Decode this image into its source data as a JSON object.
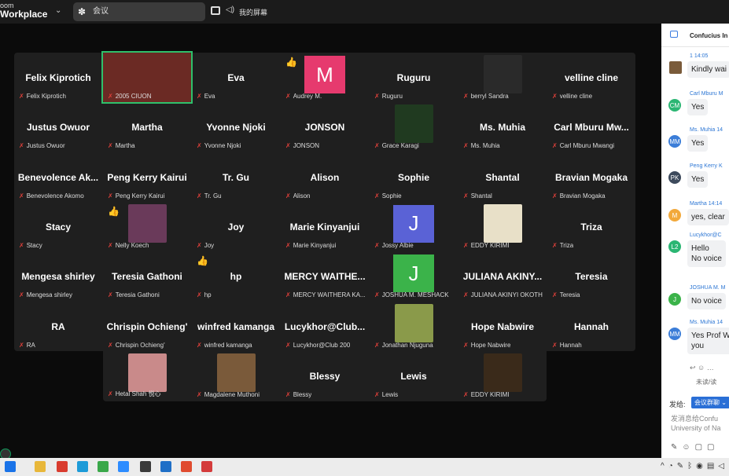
{
  "app": {
    "brand_top": "oom",
    "brand_main": "Workplace"
  },
  "meeting_tab": {
    "label": "会议"
  },
  "share_label": "我的屏幕",
  "participants": [
    {
      "name": "Felix Kiprotich",
      "label": "Felix Kiprotich"
    },
    {
      "name": "",
      "label": "2005 CIUON"
    },
    {
      "name": "Eva",
      "label": "Eva"
    },
    {
      "name": "",
      "label": "Audrey M.",
      "avatar_letter": "M",
      "emoji": "👍"
    },
    {
      "name": "Ruguru",
      "label": "Ruguru"
    },
    {
      "name": "",
      "label": "berryl Sandra"
    },
    {
      "name": "velline cline",
      "label": "velline cline"
    },
    {
      "name": "Justus Owuor",
      "label": "Justus Owuor"
    },
    {
      "name": "Martha",
      "label": "Martha"
    },
    {
      "name": "Yvonne Njoki",
      "label": "Yvonne Njoki"
    },
    {
      "name": "JONSON",
      "label": "JONSON"
    },
    {
      "name": "",
      "label": "Grace Karagi"
    },
    {
      "name": "Ms. Muhia",
      "label": "Ms. Muhia"
    },
    {
      "name": "Carl Mburu Mw...",
      "label": "Carl Mburu Mwangi"
    },
    {
      "name": "Benevolence Ak...",
      "label": "Benevolence Akomo"
    },
    {
      "name": "Peng Kerry Kairui",
      "label": "Peng Kerry Kairui"
    },
    {
      "name": "Tr. Gu",
      "label": "Tr. Gu"
    },
    {
      "name": "Alison",
      "label": "Alison"
    },
    {
      "name": "Sophie",
      "label": "Sophie"
    },
    {
      "name": "Shantal",
      "label": "Shantal"
    },
    {
      "name": "Bravian Mogaka",
      "label": "Bravian Mogaka"
    },
    {
      "name": "Stacy",
      "label": "Stacy"
    },
    {
      "name": "",
      "label": "Nelly Koech",
      "emoji": "👍"
    },
    {
      "name": "Joy",
      "label": "Joy"
    },
    {
      "name": "Marie Kinyanjui",
      "label": "Marie Kinyanjui"
    },
    {
      "name": "",
      "label": "Jossy Albie",
      "avatar_letter": "J"
    },
    {
      "name": "",
      "label": "EDDY KIRIMI"
    },
    {
      "name": "Triza",
      "label": "Triza"
    },
    {
      "name": "Mengesa shirley",
      "label": "Mengesa shirley"
    },
    {
      "name": "Teresia Gathoni",
      "label": "Teresia Gathoni"
    },
    {
      "name": "hp",
      "label": "hp",
      "emoji": "👍"
    },
    {
      "name": "MERCY WAITHE...",
      "label": "MERCY WAITHERA KA..."
    },
    {
      "name": "",
      "label": "JOSHUA M. MESHACK",
      "avatar_letter": "J"
    },
    {
      "name": "JULIANA AKINY...",
      "label": "JULIANA AKINYI OKOTH"
    },
    {
      "name": "Teresia",
      "label": "Teresia"
    },
    {
      "name": "RA",
      "label": "RA"
    },
    {
      "name": "Chrispin Ochieng'",
      "label": "Chrispin Ochieng'"
    },
    {
      "name": "winfred kamanga",
      "label": "winfred kamanga"
    },
    {
      "name": "Lucykhor@Club...",
      "label": "Lucykhor@Club 200"
    },
    {
      "name": "",
      "label": "Jonathan Njuguna"
    },
    {
      "name": "Hope Nabwire",
      "label": "Hope Nabwire"
    },
    {
      "name": "Hannah",
      "label": "Hannah"
    }
  ],
  "participants_extra": [
    {
      "name": "",
      "label": "Hetal Shah 悦心"
    },
    {
      "name": "",
      "label": "Magdalene Muthoni"
    },
    {
      "name": "Blessy",
      "label": "Blessy"
    },
    {
      "name": "Lewis",
      "label": "Lewis"
    },
    {
      "name": "",
      "label": "EDDY KIRIMI"
    }
  ],
  "chat": {
    "title": "Confucius In",
    "messages": [
      {
        "avatar": "",
        "meta": "1 14:05",
        "text": "Kindly wai",
        "color": "#7a5b3a"
      },
      {
        "avatar": "CM",
        "meta": "Carl Mburu M",
        "text": "Yes",
        "color": "#2bb673"
      },
      {
        "avatar": "MM",
        "meta": "Ms. Muhia 14",
        "text": "Yes",
        "color": "#3b7dd8"
      },
      {
        "avatar": "PK",
        "meta": "Peng Kerry K",
        "text": "Yes",
        "color": "#3d4a5c"
      },
      {
        "avatar": "M",
        "meta": "Martha 14:14",
        "text": "yes, clear",
        "color": "#f2a93b"
      },
      {
        "avatar": "L2",
        "meta": "Lucykhor@C",
        "text": "Hello\nNo voice",
        "color": "#2bb673"
      },
      {
        "avatar": "J",
        "meta": "JOSHUA M. M",
        "text": "No voice",
        "color": "#3bb34a"
      },
      {
        "avatar": "MM",
        "meta": "Ms. Muhia 14",
        "text": "Yes Prof W\nyou",
        "color": "#3b7dd8"
      }
    ],
    "read_status": "未读/读",
    "send_to_label": "发给:",
    "send_to_value": "会议群聊 ⌄",
    "input_placeholder_1": "发消息给Confu",
    "input_placeholder_2": "University of Na"
  }
}
